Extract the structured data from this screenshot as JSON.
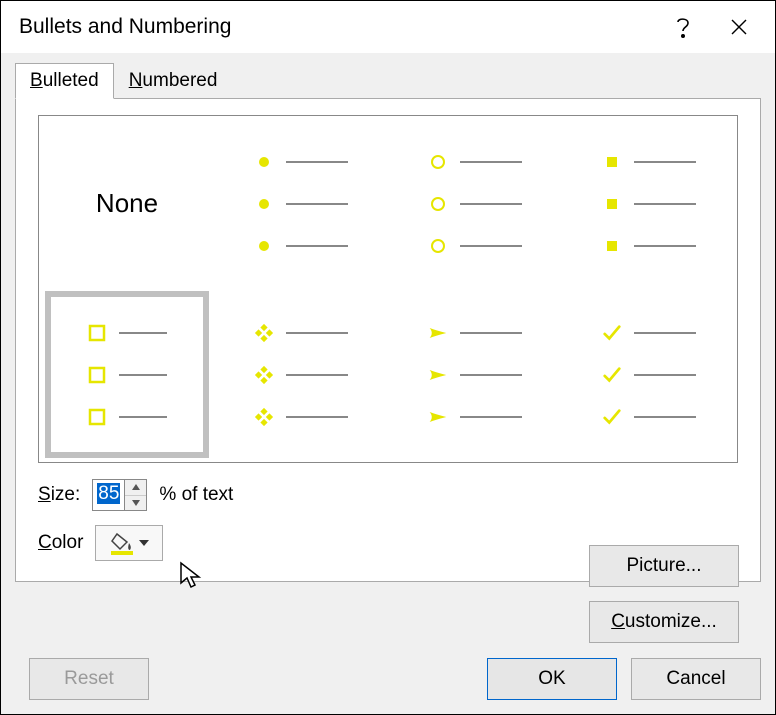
{
  "title": "Bullets and Numbering",
  "tabs": {
    "bulleted": "Bulleted",
    "numbered": "Numbered",
    "active": 0
  },
  "gallery": {
    "none_label": "None",
    "selected_index": 4
  },
  "size": {
    "label": "Size:",
    "value": "85",
    "suffix": "% of text"
  },
  "color": {
    "label": "Color",
    "swatch": "#e6e600"
  },
  "buttons": {
    "picture": "Picture...",
    "customize": "Customize...",
    "reset": "Reset",
    "ok": "OK",
    "cancel": "Cancel"
  }
}
